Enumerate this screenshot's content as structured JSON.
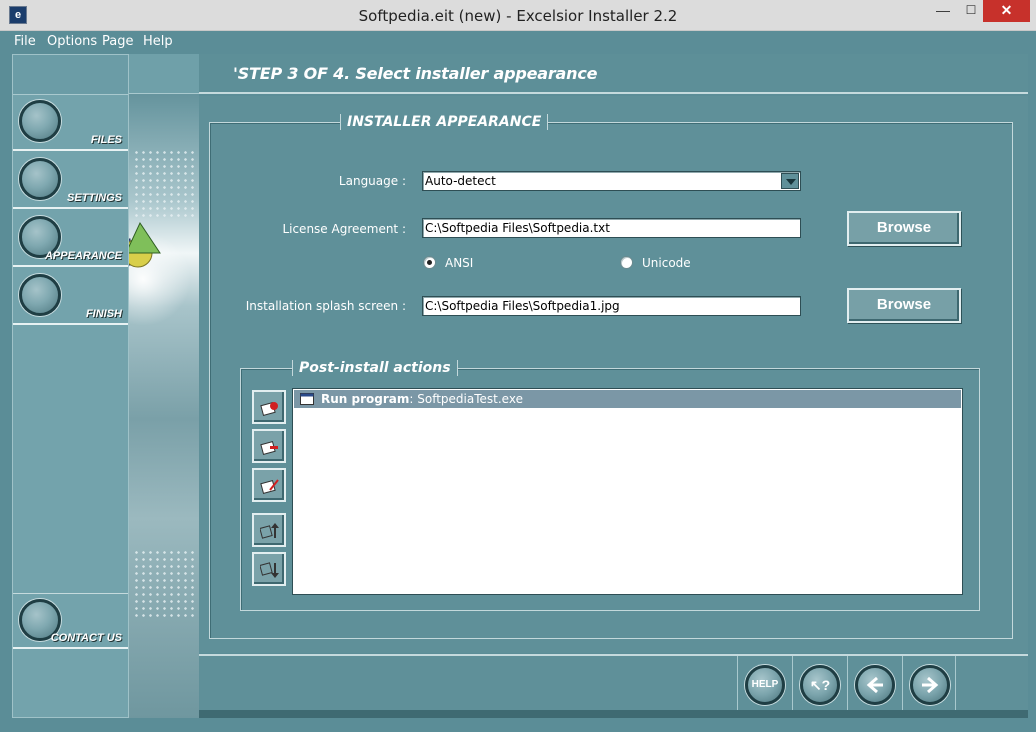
{
  "window": {
    "title": "Softpedia.eit (new) - Excelsior Installer 2.2",
    "min_label": "—",
    "max_label": "☐",
    "close_label": "✕"
  },
  "menu": [
    "File",
    "Options",
    "Page",
    "Help"
  ],
  "sidebar": {
    "items": [
      {
        "label": "FILES"
      },
      {
        "label": "SETTINGS"
      },
      {
        "label": "APPEARANCE"
      },
      {
        "label": "FINISH"
      }
    ],
    "contact_label": "CONTACT US"
  },
  "header": {
    "title": "'STEP 3 OF 4. Select installer appearance"
  },
  "appearance": {
    "group_title": "INSTALLER APPEARANCE",
    "language_label": "Language :",
    "language_value": "Auto-detect",
    "license_label": "License Agreement :",
    "license_value": "C:\\Softpedia Files\\Softpedia.txt",
    "browse_label": "Browse",
    "radio_ansi": "ANSI",
    "radio_unicode": "Unicode",
    "splash_label": "Installation splash screen :",
    "splash_value": "C:\\Softpedia Files\\Softpedia1.jpg"
  },
  "post_install": {
    "title": "Post-install actions",
    "rows": [
      {
        "action": "Run program",
        "separator": ": ",
        "target": "SoftpediaTest.exe"
      }
    ]
  },
  "bottom_nav": {
    "help_label": "HELP",
    "context_help_label": "↖?"
  },
  "colors": {
    "panel": "#5f9099",
    "sidebar": "#73a3ac",
    "selected_row": "#7b97a6",
    "close": "#c7312b"
  }
}
